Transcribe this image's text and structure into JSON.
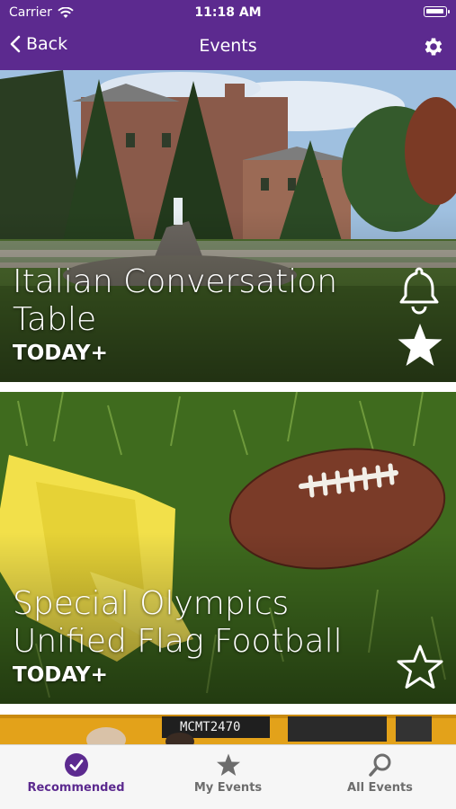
{
  "status_bar": {
    "carrier": "Carrier",
    "time": "11:18 AM"
  },
  "nav": {
    "back_label": "Back",
    "title": "Events"
  },
  "events": [
    {
      "title": "Italian Conversation Table",
      "when": "TODAY+",
      "starred": true,
      "has_bell": true
    },
    {
      "title": "Special Olympics Unified Flag Football",
      "when": "TODAY+",
      "starred": false,
      "has_bell": false
    }
  ],
  "partial_card": {
    "image_text": "MCMT2470"
  },
  "tabbar": {
    "items": [
      {
        "label": "Recommended",
        "icon": "check-circle-icon",
        "active": true
      },
      {
        "label": "My Events",
        "icon": "star-icon",
        "active": false
      },
      {
        "label": "All Events",
        "icon": "search-icon",
        "active": false
      }
    ]
  },
  "colors": {
    "brand": "#5c2a8f",
    "tab_inactive": "#6d6d6d"
  }
}
